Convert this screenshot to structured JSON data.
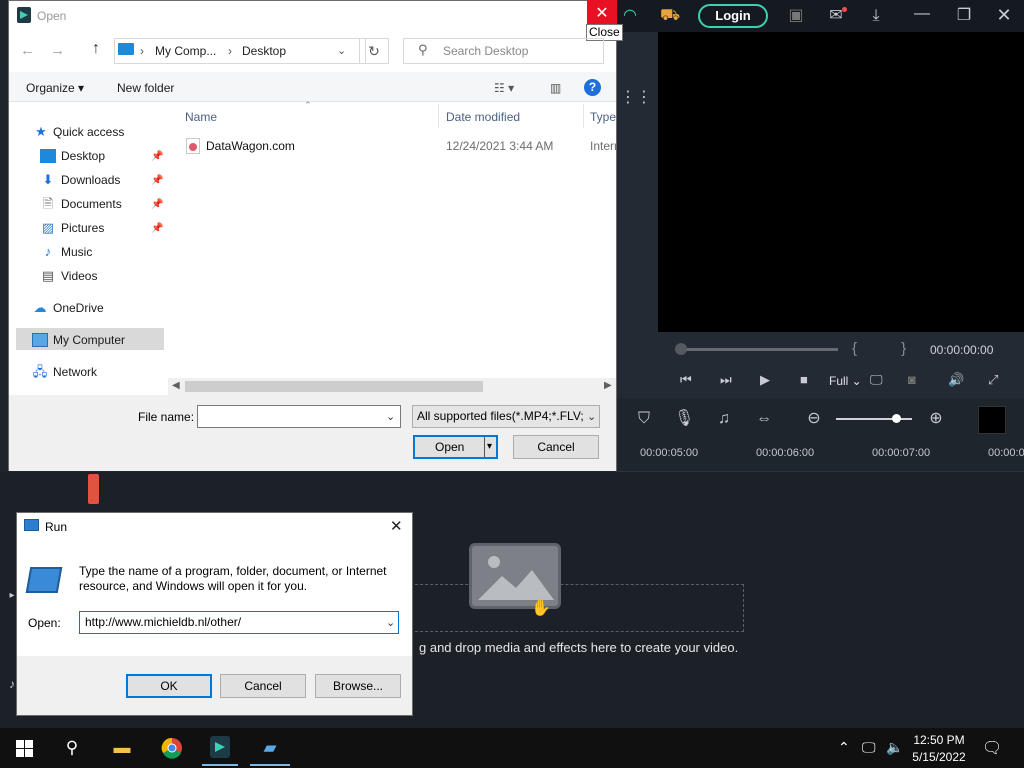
{
  "editor": {
    "login_label": "Login",
    "timecode": "00:00:00:00",
    "brackets": "{ }",
    "display_mode": "Full",
    "ruler_ticks": [
      "00:00:05:00",
      "00:00:06:00",
      "00:00:07:00",
      "00:00:0"
    ],
    "drop_text": "g and drop media and effects here to create your video."
  },
  "open_dialog": {
    "title": "Open",
    "close_tooltip": "Close",
    "breadcrumb": [
      "My Comp...",
      "Desktop"
    ],
    "search_placeholder": "Search Desktop",
    "organize_label": "Organize",
    "new_folder_label": "New folder",
    "nav": {
      "quick_access": "Quick access",
      "desktop": "Desktop",
      "downloads": "Downloads",
      "documents": "Documents",
      "pictures": "Pictures",
      "music": "Music",
      "videos": "Videos",
      "onedrive": "OneDrive",
      "my_computer": "My Computer",
      "network": "Network"
    },
    "columns": {
      "name": "Name",
      "date_modified": "Date modified",
      "type": "Type"
    },
    "files": [
      {
        "name": "DataWagon.com",
        "date_modified": "12/24/2021 3:44 AM",
        "type": "Intern"
      }
    ],
    "file_name_label": "File name:",
    "file_name_value": "",
    "filter_value": "All supported files(*.MP4;*.FLV;",
    "open_label": "Open",
    "cancel_label": "Cancel"
  },
  "run_dialog": {
    "title": "Run",
    "description": "Type the name of a program, folder, document, or Internet resource, and Windows will open it for you.",
    "open_label": "Open:",
    "open_value": "http://www.michieldb.nl/other/",
    "ok_label": "OK",
    "cancel_label": "Cancel",
    "browse_label": "Browse..."
  },
  "taskbar": {
    "time": "12:50 PM",
    "date": "5/15/2022"
  }
}
